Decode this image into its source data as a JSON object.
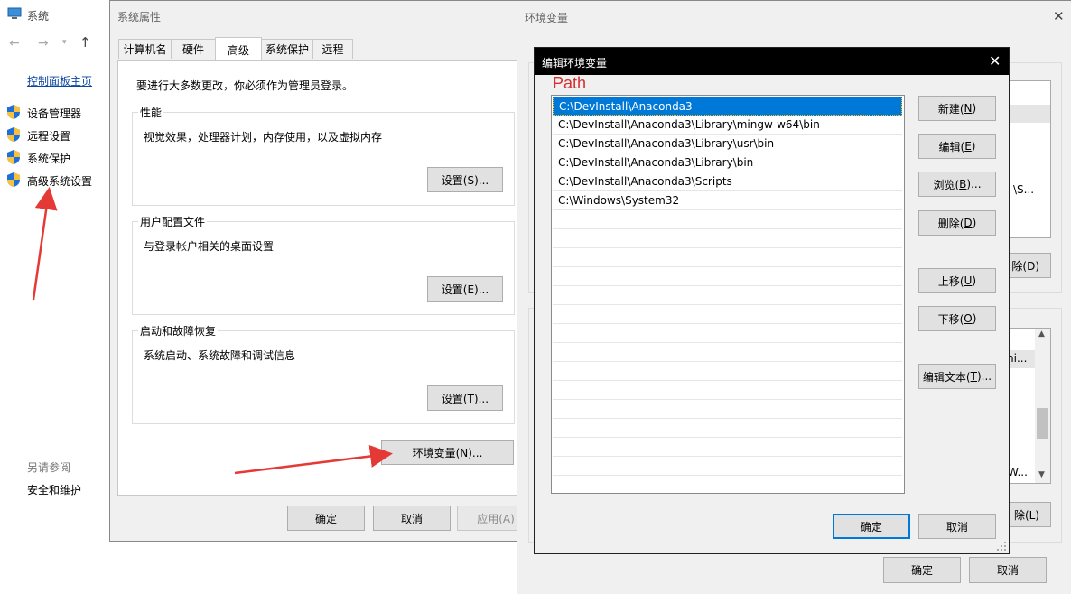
{
  "system_window": {
    "title": "系统",
    "nav_up": "↑",
    "control_panel_home": "控制面板主页",
    "links": [
      "设备管理器",
      "远程设置",
      "系统保护",
      "高级系统设置"
    ],
    "see_also_label": "另请参阅",
    "see_also_link": "安全和维护"
  },
  "sysprops": {
    "title": "系统属性",
    "tabs": [
      "计算机名",
      "硬件",
      "高级",
      "系统保护",
      "远程"
    ],
    "active_tab": "高级",
    "admin_note": "要进行大多数更改，你必须作为管理员登录。",
    "groups": [
      {
        "title": "性能",
        "desc": "视觉效果，处理器计划，内存使用，以及虚拟内存",
        "button": "设置(S)..."
      },
      {
        "title": "用户配置文件",
        "desc": "与登录帐户相关的桌面设置",
        "button": "设置(E)..."
      },
      {
        "title": "启动和故障恢复",
        "desc": "系统启动、系统故障和调试信息",
        "button": "设置(T)..."
      }
    ],
    "env_button": "环境变量(N)...",
    "ok": "确定",
    "cancel": "取消",
    "apply": "应用(A)"
  },
  "envvars": {
    "title": "环境变量",
    "close_icon": "✕",
    "partial_text_1": "\\S...",
    "partial_delete_1": "除(D)",
    "partial_text_2": "hi...",
    "partial_text_3": "W...",
    "partial_delete_2": "除(L)",
    "ok": "确定",
    "cancel": "取消"
  },
  "edit_dialog": {
    "title": "编辑环境变量",
    "close_icon": "✕",
    "var_name": "Path",
    "entries": [
      "C:\\DevInstall\\Anaconda3",
      "C:\\DevInstall\\Anaconda3\\Library\\mingw-w64\\bin",
      "C:\\DevInstall\\Anaconda3\\Library\\usr\\bin",
      "C:\\DevInstall\\Anaconda3\\Library\\bin",
      "C:\\DevInstall\\Anaconda3\\Scripts",
      "C:\\Windows\\System32"
    ],
    "buttons": {
      "new": {
        "label": "新建(",
        "key": "N",
        "end": ")"
      },
      "edit": {
        "label": "编辑(",
        "key": "E",
        "end": ")"
      },
      "browse": {
        "label": "浏览(",
        "key": "B",
        "end": ")..."
      },
      "delete": {
        "label": "删除(",
        "key": "D",
        "end": ")"
      },
      "up": {
        "label": "上移(",
        "key": "U",
        "end": ")"
      },
      "down": {
        "label": "下移(",
        "key": "O",
        "end": ")"
      },
      "edit_text": {
        "label": "编辑文本(",
        "key": "T",
        "end": ")..."
      }
    },
    "ok": "确定",
    "cancel": "取消"
  },
  "colors": {
    "accent": "#0078d7",
    "arrow": "#e53935",
    "path_label": "#d32f2f"
  }
}
